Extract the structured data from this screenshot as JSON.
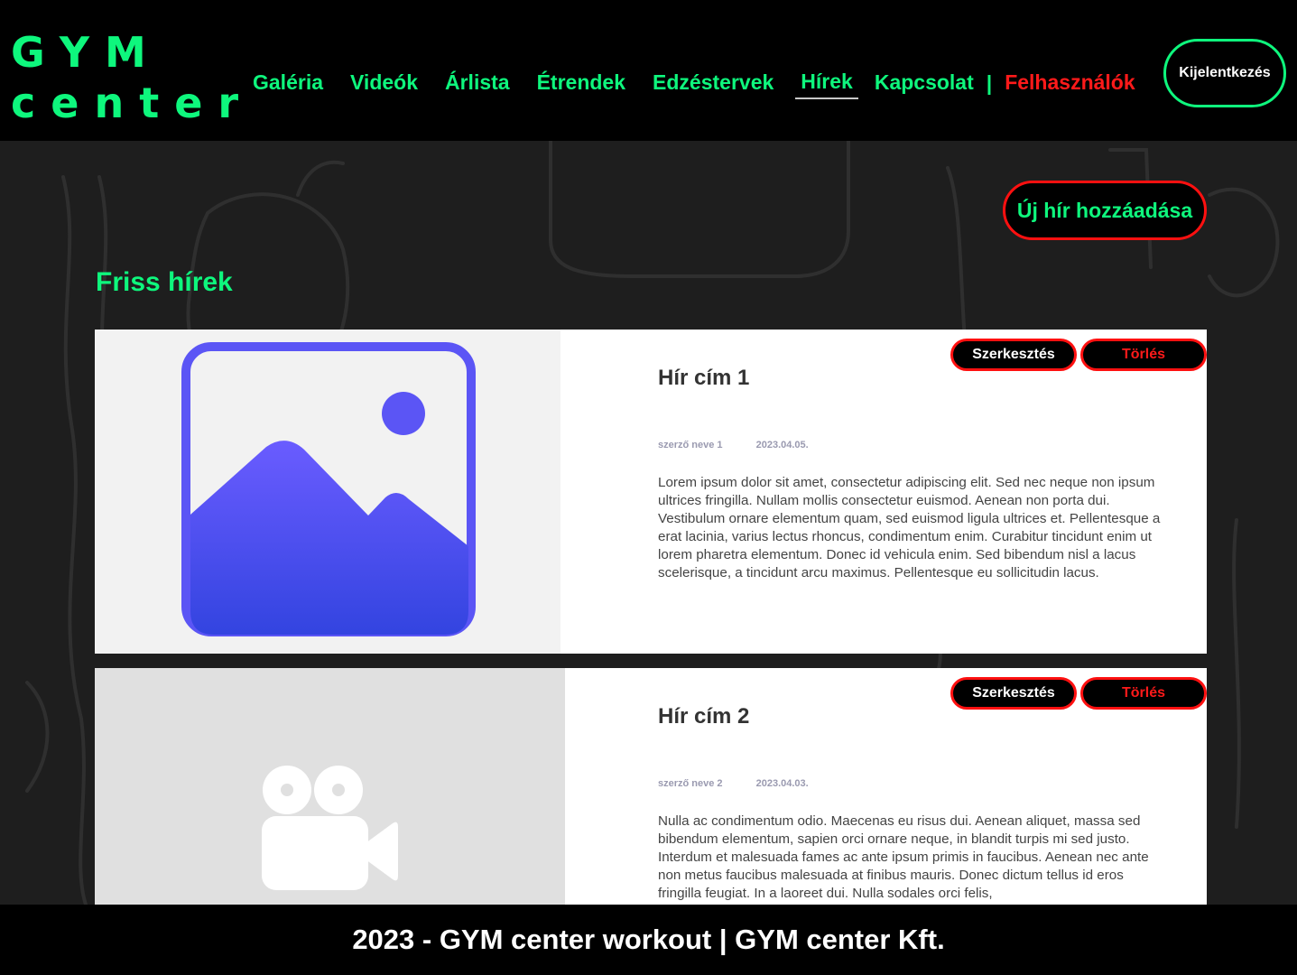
{
  "header": {
    "logo_line1": "GYM",
    "logo_line2": "center",
    "nav": [
      {
        "label": "Galéria"
      },
      {
        "label": "Videók"
      },
      {
        "label": "Árlista"
      },
      {
        "label": "Étrendek"
      },
      {
        "label": "Edzéstervek"
      },
      {
        "label": "Hírek",
        "active": true
      },
      {
        "label": "Kapcsolat"
      }
    ],
    "separator": "|",
    "users_label": "Felhasználók",
    "logout_label": "Kijelentkezés"
  },
  "main": {
    "add_button_label": "Új hír hozzáadása",
    "section_title": "Friss hírek",
    "news": [
      {
        "title": "Hír cím 1",
        "author": "szerző neve 1",
        "date": "2023.04.05.",
        "body": "Lorem ipsum dolor sit amet, consectetur adipiscing elit. Sed nec neque non ipsum ultrices fringilla. Nullam mollis consectetur euismod. Aenean non porta dui. Vestibulum ornare elementum quam, sed euismod ligula ultrices et. Pellentesque a erat lacinia, varius lectus rhoncus, condimentum enim. Curabitur tincidunt enim ut lorem pharetra elementum. Donec id vehicula enim. Sed bibendum nisl a lacus scelerisque, a tincidunt arcu maximus. Pellentesque eu sollicitudin lacus.",
        "media_icon": "image-placeholder-icon",
        "edit_label": "Szerkesztés",
        "delete_label": "Törlés"
      },
      {
        "title": "Hír cím 2",
        "author": "szerző neve 2",
        "date": "2023.04.03.",
        "body": "Nulla ac condimentum odio. Maecenas eu risus dui. Aenean aliquet, massa sed bibendum elementum, sapien orci ornare neque, in blandit turpis mi sed justo. Interdum et malesuada fames ac ante ipsum primis in faucibus. Aenean nec ante non metus faucibus malesuada at finibus mauris. Donec dictum tellus id eros fringilla feugiat. In a laoreet dui. Nulla sodales orci felis,",
        "media_icon": "video-camera-icon",
        "edit_label": "Szerkesztés",
        "delete_label": "Törlés"
      }
    ]
  },
  "footer": {
    "text": "2023 - GYM center workout | GYM center Kft."
  },
  "colors": {
    "accent": "#0ef77d",
    "danger": "#ff1010",
    "image_icon": "#5b55f5"
  }
}
